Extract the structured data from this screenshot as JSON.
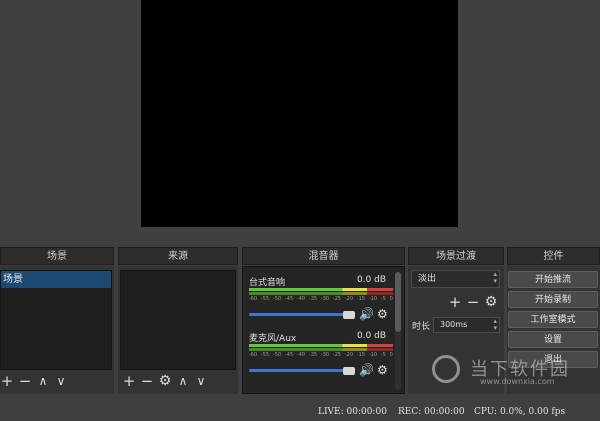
{
  "docks": {
    "scenes": {
      "title": "场景",
      "items": [
        "场景"
      ]
    },
    "sources": {
      "title": "来源"
    },
    "mixer": {
      "title": "混音器",
      "channels": [
        {
          "name": "台式音响",
          "db": "0.0 dB",
          "scale": [
            "-60",
            "-55",
            "-50",
            "-45",
            "-40",
            "-35",
            "-30",
            "-25",
            "-20",
            "-15",
            "-10",
            "-5",
            "0"
          ]
        },
        {
          "name": "麦克风/Aux",
          "db": "0.0 dB",
          "scale": [
            "-60",
            "-55",
            "-50",
            "-45",
            "-40",
            "-35",
            "-30",
            "-25",
            "-20",
            "-15",
            "-10",
            "-5",
            "0"
          ]
        }
      ]
    },
    "transitions": {
      "title": "场景过渡",
      "selected": "淡出",
      "duration_label": "时长",
      "duration_value": "300ms"
    },
    "controls": {
      "title": "控件",
      "buttons": [
        "开始推流",
        "开始录制",
        "工作室模式",
        "设置",
        "退出"
      ]
    }
  },
  "status": {
    "live": "LIVE: 00:00:00",
    "rec": "REC: 00:00:00",
    "cpu": "CPU: 0.0%, 0.00 fps"
  },
  "watermark": {
    "text": "当下软件园",
    "url": "www.downxia.com"
  },
  "icons": {
    "add": "+",
    "remove": "−",
    "up": "∧",
    "down": "∨",
    "gear": "⚙",
    "speaker": "🔊"
  },
  "colors": {
    "selection": "#1d4a73",
    "slider": "#3b78c8",
    "meter_green": "#5ecb34",
    "meter_yellow": "#e8e43a",
    "meter_red": "#d84040"
  }
}
